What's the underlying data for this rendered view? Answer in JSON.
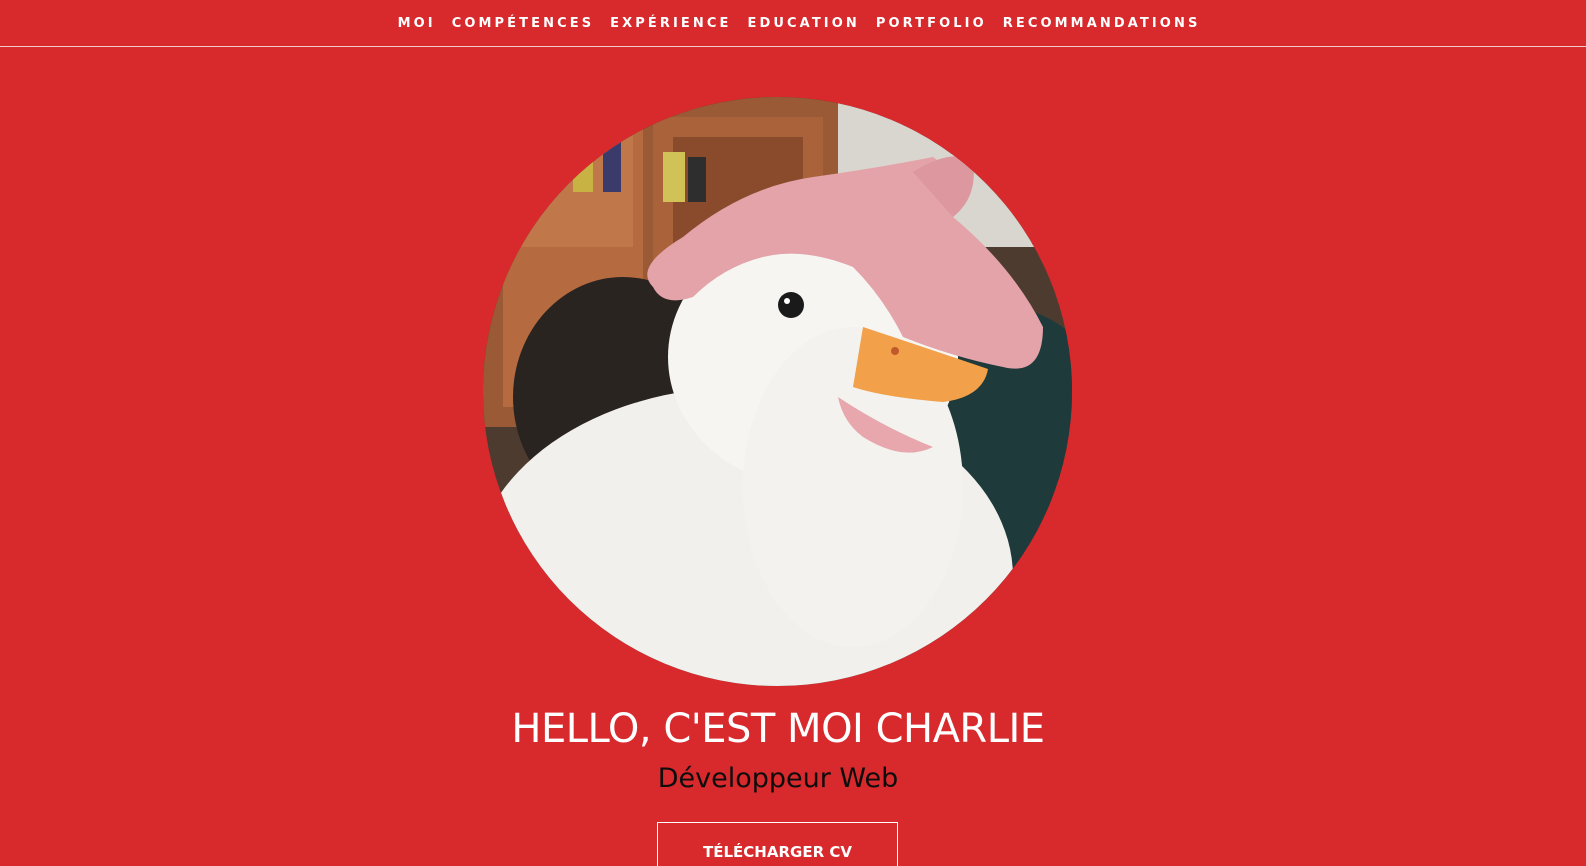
{
  "nav": {
    "items": [
      {
        "label": "MOI"
      },
      {
        "label": "COMPÉTENCES"
      },
      {
        "label": "EXPÉRIENCE"
      },
      {
        "label": "EDUCATION"
      },
      {
        "label": "PORTFOLIO"
      },
      {
        "label": "RECOMMANDATIONS"
      }
    ]
  },
  "hero": {
    "avatar_alt": "white duck being petted",
    "title": "HELLO, C'EST MOI CHARLIE",
    "subtitle": "Développeur Web",
    "cta_label": "TÉLÉCHARGER CV"
  },
  "colors": {
    "background": "#d8292d",
    "text_light": "#ffffff",
    "text_dark": "#0d0d0d",
    "nav_divider": "#f3c9ca"
  }
}
